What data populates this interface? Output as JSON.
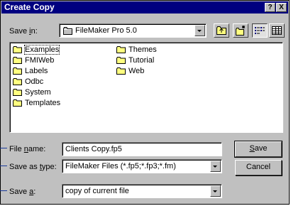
{
  "window": {
    "title": "Create Copy",
    "help_glyph": "?",
    "close_glyph": "X"
  },
  "save_in": {
    "label_pre": "Save ",
    "label_u": "i",
    "label_post": "n:",
    "value": "FileMaker Pro 5.0"
  },
  "toolbar": [
    "up-one-level-icon",
    "create-new-folder-icon",
    "list-view-icon",
    "details-view-icon"
  ],
  "files": [
    {
      "name": "Examples",
      "selected": true
    },
    {
      "name": "FMIWeb"
    },
    {
      "name": "Labels"
    },
    {
      "name": "Odbc"
    },
    {
      "name": "System"
    },
    {
      "name": "Templates"
    },
    {
      "name": "Themes"
    },
    {
      "name": "Tutorial"
    },
    {
      "name": "Web"
    }
  ],
  "file_name": {
    "label_pre": "File ",
    "label_u": "n",
    "label_post": "ame:",
    "value": "Clients Copy.fp5"
  },
  "save_as_type": {
    "label_pre": "Save as ",
    "label_u": "t",
    "label_post": "ype:",
    "value": "FileMaker Files (*.fp5;*.fp3;*.fm)"
  },
  "save_a": {
    "label_pre": "Save ",
    "label_u": "a",
    "label_post": ":",
    "value": "copy of current file"
  },
  "buttons": {
    "save_u": "S",
    "save_rest": "ave",
    "cancel": "Cancel"
  },
  "colors": {
    "titlebar": "#000080",
    "face": "#c0c0c0",
    "folder": "#ffff80",
    "callout": "#1a3a9a"
  }
}
